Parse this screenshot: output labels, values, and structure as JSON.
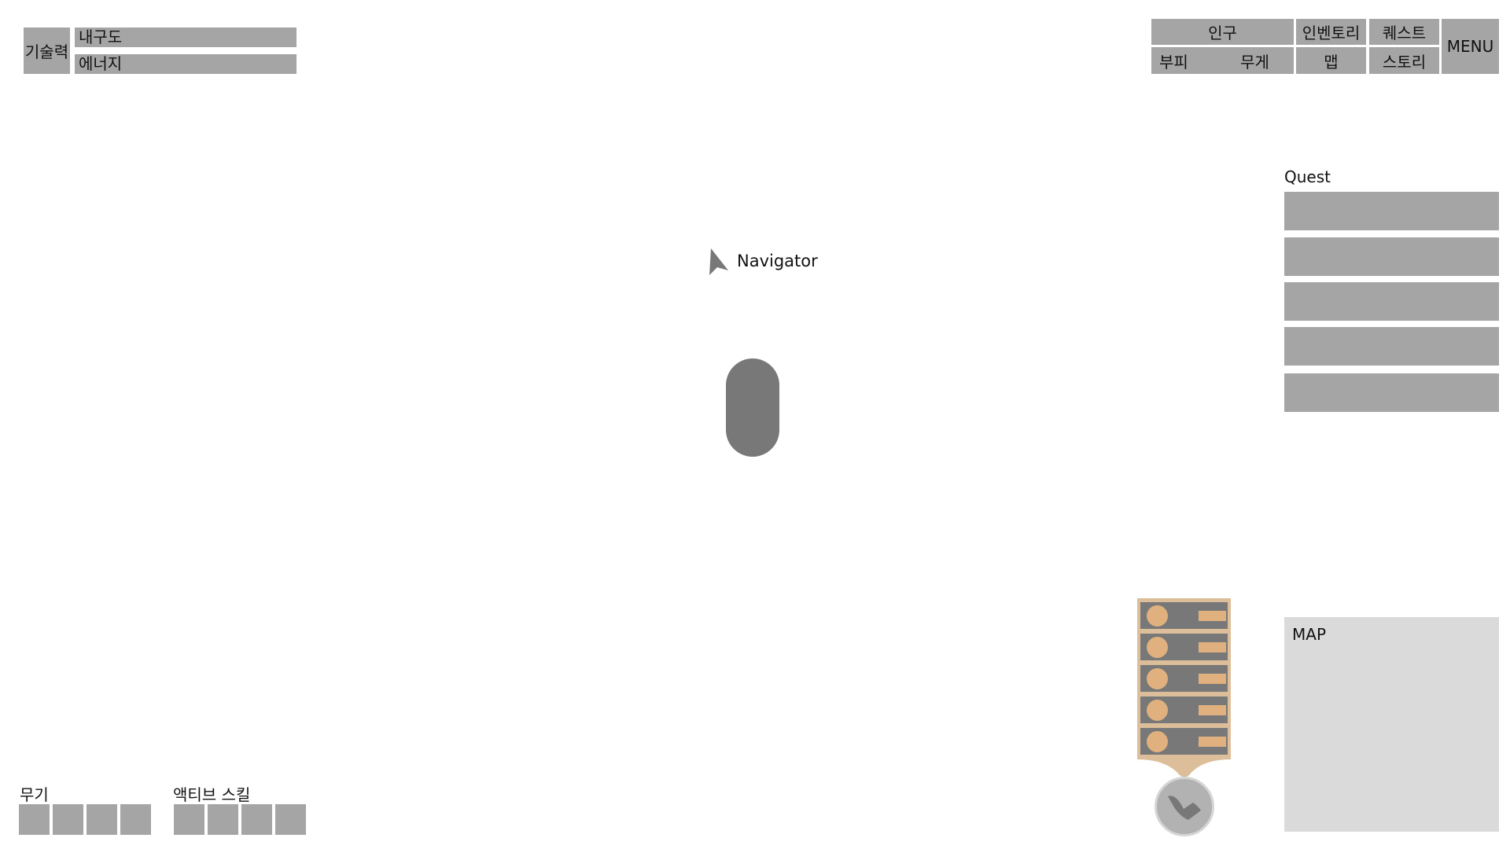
{
  "hud": {
    "stats": {
      "main_label": "기술력",
      "durability_label": "내구도",
      "energy_label": "에너지"
    },
    "menu": {
      "population_label": "인구",
      "volume_label": "부피",
      "weight_label": "무게",
      "inventory_label": "인벤토리",
      "map_label": "맵",
      "quest_label": "퀘스트",
      "story_label": "스토리",
      "menu_label": "MENU"
    },
    "quest": {
      "title": "Quest",
      "slots": [
        "",
        "",
        "",
        "",
        ""
      ]
    },
    "navigator": {
      "label": "Navigator"
    },
    "minimap": {
      "label": "MAP"
    },
    "weapons": {
      "title": "무기",
      "slots": [
        "",
        "",
        "",
        ""
      ]
    },
    "active_skills": {
      "title": "액티브 스킬",
      "slots": [
        "",
        "",
        "",
        ""
      ]
    },
    "party": {
      "members": [
        "",
        "",
        "",
        "",
        ""
      ]
    }
  },
  "colors": {
    "panel_gray": "#a5a5a5",
    "player": "#787878",
    "party_accent": "#e0b17e",
    "map_bg": "#dadada"
  },
  "icons": {
    "navigator": "navigator-arrow-icon",
    "skill": "boomerang-icon"
  }
}
